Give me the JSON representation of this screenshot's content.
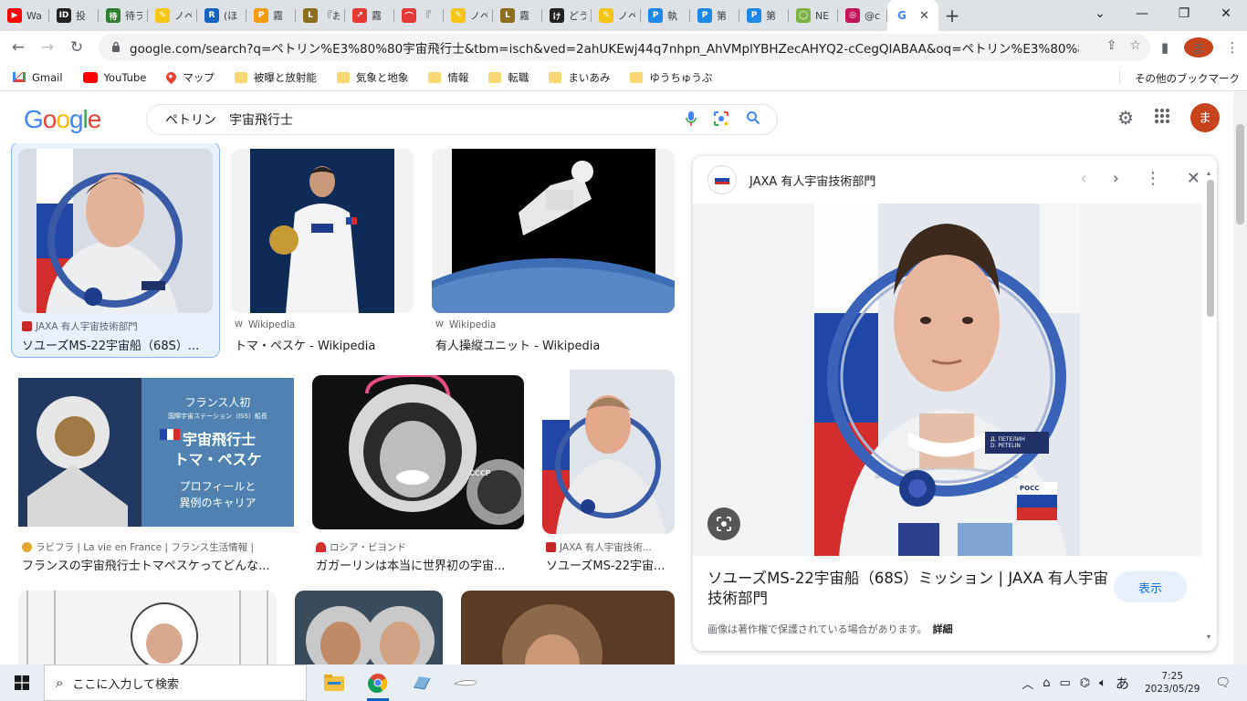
{
  "tabs": [
    {
      "favicon_color": "#ff0000",
      "favicon_text": "▶",
      "title": "Wa"
    },
    {
      "favicon_color": "#222222",
      "favicon_text": "ID",
      "title": "投"
    },
    {
      "favicon_color": "#2e7d32",
      "favicon_text": "待",
      "title": "待ヲ"
    },
    {
      "favicon_color": "#f5c518",
      "favicon_text": "✎",
      "title": "ノベ"
    },
    {
      "favicon_color": "#1565c0",
      "favicon_text": "R",
      "title": "(ほ"
    },
    {
      "favicon_color": "#f39c12",
      "favicon_text": "P",
      "title": "霧"
    },
    {
      "favicon_color": "#8d6e1f",
      "favicon_text": "L",
      "title": "『お"
    },
    {
      "favicon_color": "#e53935",
      "favicon_text": "↗",
      "title": "霧"
    },
    {
      "favicon_color": "#e53935",
      "favicon_text": "⌒",
      "title": "『"
    },
    {
      "favicon_color": "#f5c518",
      "favicon_text": "✎",
      "title": "ノベ"
    },
    {
      "favicon_color": "#8d6e1f",
      "favicon_text": "L",
      "title": "霧"
    },
    {
      "favicon_color": "#222222",
      "favicon_text": "け",
      "title": "どう"
    },
    {
      "favicon_color": "#f5c518",
      "favicon_text": "✎",
      "title": "ノベ"
    },
    {
      "favicon_color": "#1e88e5",
      "favicon_text": "P",
      "title": "執"
    },
    {
      "favicon_color": "#1e88e5",
      "favicon_text": "P",
      "title": "第"
    },
    {
      "favicon_color": "#1e88e5",
      "favicon_text": "P",
      "title": "第"
    },
    {
      "favicon_color": "#7cb342",
      "favicon_text": "◯",
      "title": "NE"
    },
    {
      "favicon_color": "#c2185b",
      "favicon_text": "◎",
      "title": "@c"
    }
  ],
  "active_tab": {
    "favicon_text": "G",
    "title": "G"
  },
  "window_controls": [
    "⌄",
    "—",
    "❐",
    "✕"
  ],
  "url": "google.com/search?q=ペトリン%E3%80%80宇宙飛行士&tbm=isch&ved=2ahUKEwj44q7nhpn_AhVMplYBHZecAHYQ2-cCegQIABAA&oq=ペトリン%E3%80%80宇宙飛行士...",
  "profile_initial": "ま",
  "bookmarks": [
    {
      "label": "Gmail",
      "type": "gmail"
    },
    {
      "label": "YouTube",
      "type": "youtube"
    },
    {
      "label": "マップ",
      "type": "maps"
    },
    {
      "label": "被曝と放射能",
      "type": "folder"
    },
    {
      "label": "気象と地象",
      "type": "folder"
    },
    {
      "label": "情報",
      "type": "folder"
    },
    {
      "label": "転職",
      "type": "folder"
    },
    {
      "label": "まいあみ",
      "type": "folder"
    },
    {
      "label": "ゆうちゅうぶ",
      "type": "folder"
    }
  ],
  "other_bookmarks": "その他のブックマーク",
  "search": {
    "query": "ペトリン　宇宙飛行士"
  },
  "results": [
    {
      "source": "JAXA 有人宇宙技術部門",
      "title": "ソユーズMS-22宇宙船（68S）...",
      "src_color": "#c62828"
    },
    {
      "source": "Wikipedia",
      "title": "トマ・ペスケ - Wikipedia",
      "src_color": "#555555"
    },
    {
      "source": "Wikipedia",
      "title": "有人操縦ユニット - Wikipedia",
      "src_color": "#555555"
    },
    {
      "source": "ラビフラ | La vie en France | フランス生活情報 |",
      "title": "フランスの宇宙飛行士トマペスケってどんな...",
      "src_color": "#e0a82e"
    },
    {
      "source": "ロシア・ビヨンド",
      "title": "ガガーリンは本当に世界初の宇宙...",
      "src_color": "#d32f2f"
    },
    {
      "source": "JAXA 有人宇宙技術...",
      "title": "ソユーズMS-22宇宙...",
      "src_color": "#c62828"
    }
  ],
  "promo": {
    "line1": "フランス人初",
    "line2": "国際宇宙ステーション（ISS）船長",
    "line3": "宇宙飛行士",
    "line4": "トマ・ペスケ",
    "line5": "プロフィールと",
    "line6": "異例のキャリア"
  },
  "gagarin_helmet_text": "СССР",
  "suit_badge_text": "Д. ПЕТЕЛИН\nD. PETELIN",
  "flag_text": "РОСС",
  "panel": {
    "source": "JAXA 有人宇宙技術部門",
    "title": "ソユーズMS-22宇宙船（68S）ミッション | JAXA 有人宇宙技術部門",
    "button": "表示",
    "note": "画像は著作権で保護されている場合があります。",
    "note_link": "詳細"
  },
  "taskbar": {
    "search_placeholder": "ここに入力して検索",
    "ime": "あ",
    "time": "7:25",
    "date": "2023/05/29"
  },
  "colors": {
    "google_blue": "#4285f4",
    "google_red": "#ea4335",
    "google_yellow": "#fbbc05",
    "google_green": "#34a853",
    "link_blue": "#1a73e8",
    "selected_bg": "#e8f0fe"
  }
}
